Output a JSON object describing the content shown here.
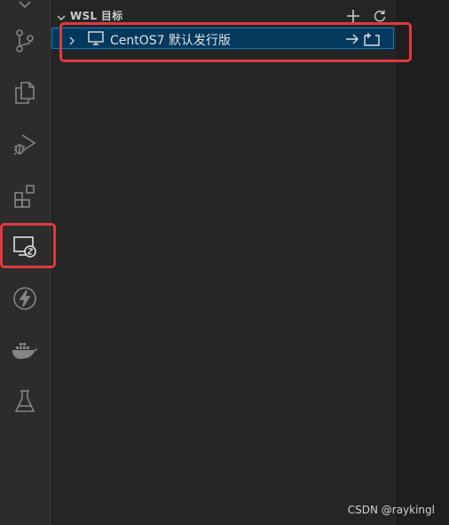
{
  "sidebar": {
    "section_title": "WSL 目标",
    "targets": [
      {
        "label": "CentOS7  默认发行版"
      }
    ]
  },
  "activity_bar": {
    "items": [
      {
        "icon": "source-control-icon"
      },
      {
        "icon": "explorer-icon"
      },
      {
        "icon": "run-debug-icon"
      },
      {
        "icon": "extensions-icon"
      },
      {
        "icon": "remote-explorer-icon",
        "active": true
      },
      {
        "icon": "lightning-icon"
      },
      {
        "icon": "docker-icon"
      },
      {
        "icon": "testing-icon"
      }
    ]
  },
  "colors": {
    "highlight": "#e0393e",
    "selection_bg": "#04395e",
    "focus_border": "#007fd4"
  },
  "watermark": "CSDN @raykingl"
}
